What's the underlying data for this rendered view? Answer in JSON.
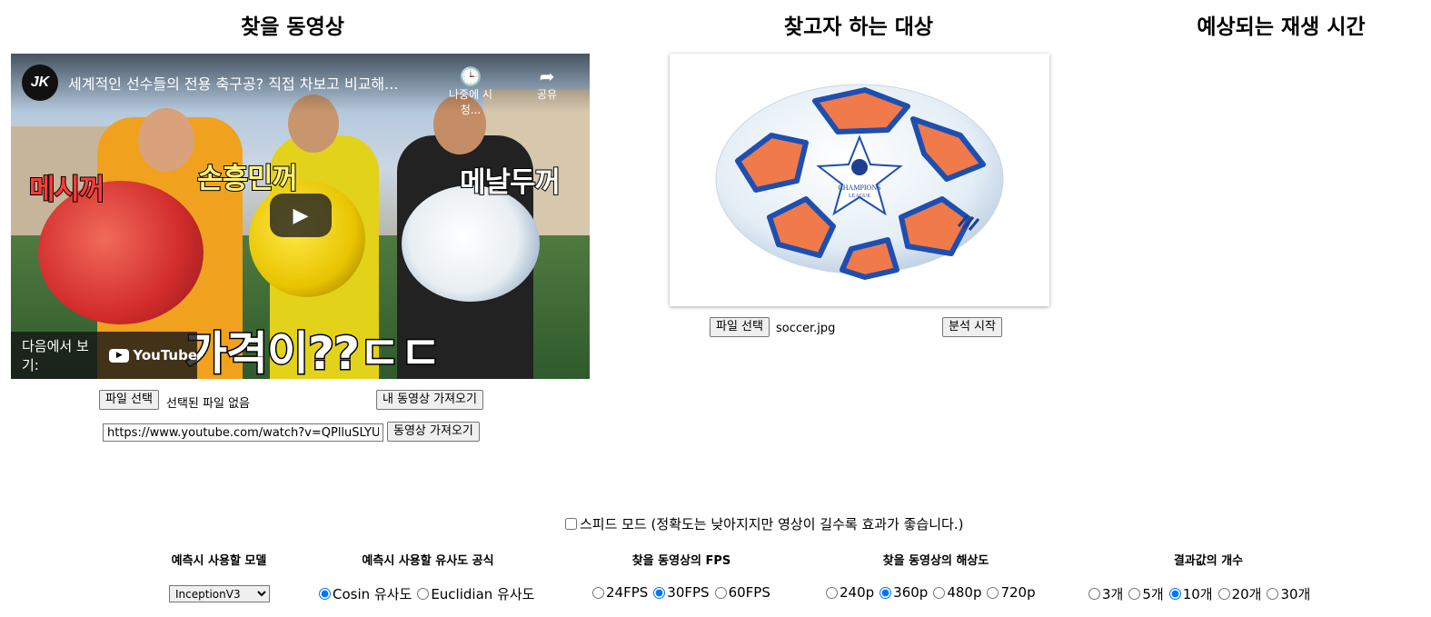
{
  "headers": {
    "video": "찾을 동영상",
    "target": "찾고자 하는 대상",
    "time": "예상되는 재생 시간"
  },
  "video": {
    "channel_logo": "JK",
    "title": "세계적인 선수들의 전용 축구공? 직접 차보고 비교해...",
    "watch_later": "나중에 시청...",
    "share": "공유",
    "overlay_messi": "메시꺼",
    "overlay_son": "손흥민꺼",
    "overlay_ronaldo": "메날두꺼",
    "overlay_price": "가격이??ㄷㄷ",
    "watch_on": "다음에서 보기:",
    "youtube": "YouTube"
  },
  "video_controls": {
    "file_button": "파일 선택",
    "file_status": "선택된 파일 없음",
    "my_video_button": "내 동영상 가져오기",
    "url_value": "https://www.youtube.com/watch?v=QPlluSLYUEo",
    "fetch_button": "동영상 가져오기"
  },
  "target": {
    "ball_text_1": "CHAMPIONS",
    "ball_text_2": "LEAGUE",
    "file_button": "파일 선택",
    "file_name": "soccer.jpg",
    "analyze_button": "분석 시작"
  },
  "speed_mode": {
    "label": "스피드 모드 (정확도는 낮아지지만 영상이 길수록 효과가 좋습니다.)",
    "checked": false
  },
  "options": {
    "model": {
      "title": "예측시 사용할 모델",
      "selected": "InceptionV3"
    },
    "similarity": {
      "title": "예측시 사용할 유사도 공식",
      "choices": [
        "Cosin 유사도",
        "Euclidian 유사도"
      ],
      "selected": "Cosin 유사도"
    },
    "fps": {
      "title": "찾을 동영상의 FPS",
      "choices": [
        "24FPS",
        "30FPS",
        "60FPS"
      ],
      "selected": "30FPS"
    },
    "resolution": {
      "title": "찾을 동영상의 해상도",
      "choices": [
        "240p",
        "360p",
        "480p",
        "720p"
      ],
      "selected": "360p"
    },
    "count": {
      "title": "결과값의 개수",
      "choices": [
        "3개",
        "5개",
        "10개",
        "20개",
        "30개"
      ],
      "selected": "10개"
    }
  },
  "colors": {
    "accent": "#0075ff",
    "button_bg": "#efefef"
  }
}
